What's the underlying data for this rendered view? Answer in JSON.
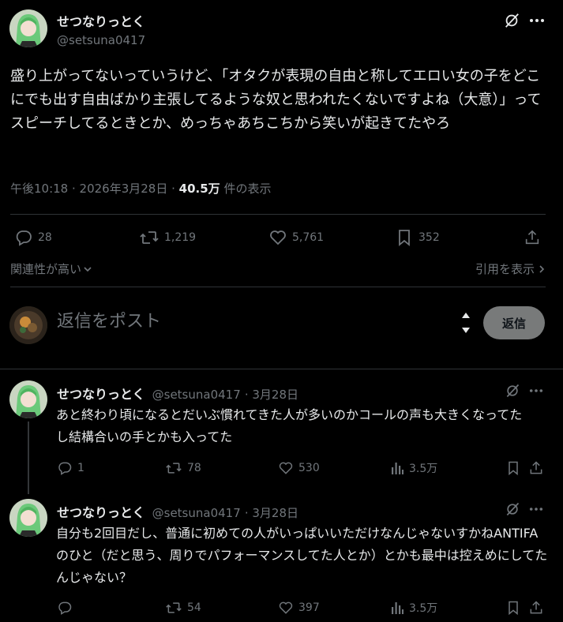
{
  "main": {
    "author_name": "せつなりっとく",
    "author_handle": "@setsuna0417",
    "text": "盛り上がってないっていうけど、「オタクが表現の自由と称してエロい女の子をどこにでも出す自由ばかり主張してるような奴と思われたくないですよね（大意）」ってスピーチしてるときとか、めっちゃあちこちから笑いが起きてたやろ",
    "time": "午後10:18 · 2026年3月28日 · ",
    "views_count": "40.5万",
    "views_label": " 件の表示",
    "stats": {
      "replies": "28",
      "reposts": "1,219",
      "likes": "5,761",
      "bookmarks": "352"
    },
    "relevance_label": "関連性が高い",
    "quotes_label": "引用を表示"
  },
  "composer": {
    "placeholder": "返信をポスト",
    "reply_button": "返信"
  },
  "replies": [
    {
      "author_name": "せつなりっとく",
      "author_handle": "@setsuna0417",
      "date": "3月28日",
      "text": "あと終わり頃になるとだいぶ慣れてきた人が多いのかコールの声も大きくなってたし結構合いの手とかも入ってた",
      "replies": "1",
      "reposts": "78",
      "likes": "530",
      "views": "3.5万"
    },
    {
      "author_name": "せつなりっとく",
      "author_handle": "@setsuna0417",
      "date": "3月28日",
      "text": "自分も2回目だし、普通に初めての人がいっぱいいただけなんじゃないすかねANTIFAのひと（だと思う、周りでパフォーマンスしてた人とか）とかも最中は控えめにしてたんじゃない？",
      "replies": "",
      "reposts": "54",
      "likes": "397",
      "views": "3.5万"
    }
  ],
  "colors": {
    "background": "#000000",
    "text": "#e7e9ea",
    "muted": "#71767b",
    "divider": "#2f3336",
    "button": "#787a7a"
  },
  "icons": [
    "grok-icon",
    "more-icon",
    "reply-icon",
    "repost-icon",
    "like-icon",
    "bookmark-icon",
    "share-icon",
    "views-icon",
    "chevron-down-icon",
    "chevron-right-icon",
    "scroll-arrows-icon"
  ]
}
